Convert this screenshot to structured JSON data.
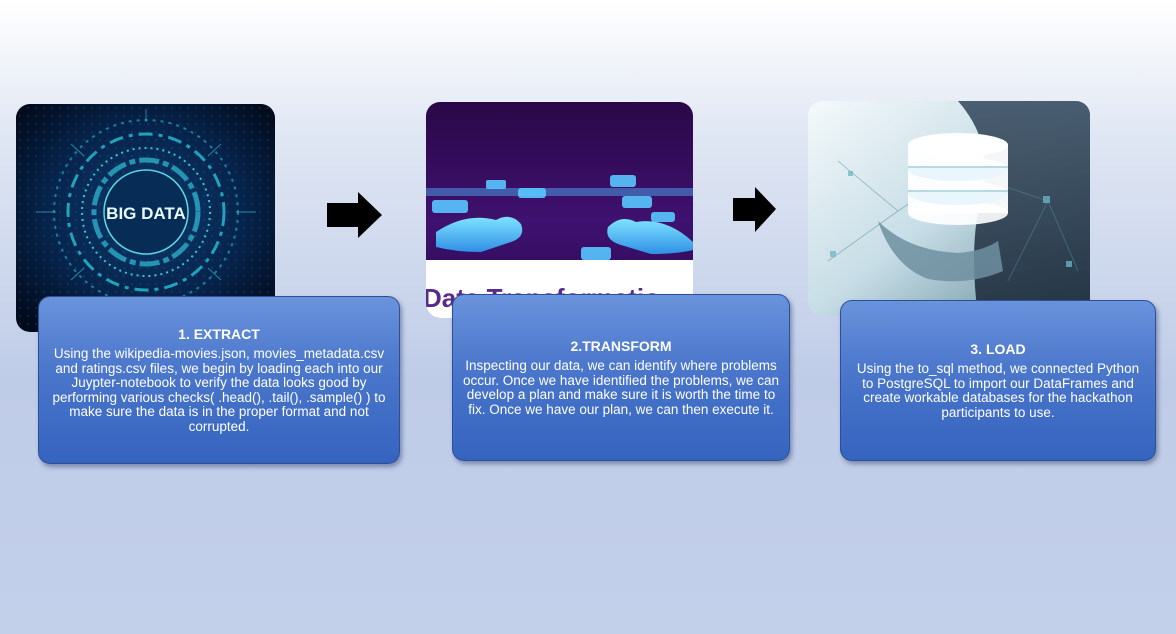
{
  "steps": [
    {
      "title": "1. EXTRACT",
      "body": "Using the wikipedia-movies.json, movies_metadata.csv and ratings.csv files, we begin by loading each into our Juypter-notebook to verify the data looks good by performing various checks( .head(), .tail(), .sample() ) to make sure the data is in the proper format and not corrupted.",
      "image_text": "BIG DATA"
    },
    {
      "title": "2.TRANSFORM",
      "body": "Inspecting our data, we can identify where problems occur. Once we have identified the problems, we can develop a plan and make sure it is worth the time to fix. Once we have our plan, we can then execute it.",
      "image_text": "Data Transformatio"
    },
    {
      "title": "3. LOAD",
      "body": "Using the to_sql method, we connected Python to PostgreSQL to import our DataFrames and create workable databases for the hackathon participants to use."
    }
  ],
  "colors": {
    "box_fill": "#4a76cb",
    "box_border": "#2d4f96",
    "arrow": "#000000",
    "card1_bg": "#051a3a",
    "card2_bg": "#3a0d5e",
    "card3_bg": "#e8f1f6"
  }
}
